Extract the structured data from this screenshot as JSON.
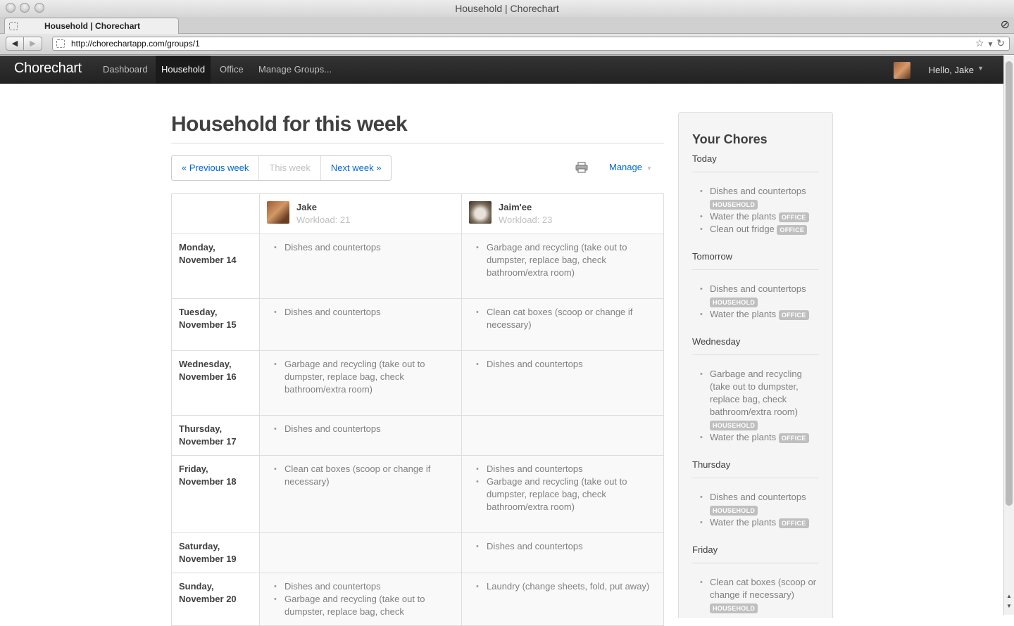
{
  "window": {
    "title": "Household | Chorechart",
    "tab_title": "Household | Chorechart",
    "url": "http://chorechartapp.com/groups/1"
  },
  "nav": {
    "brand": "Chorechart",
    "links": [
      "Dashboard",
      "Household",
      "Office",
      "Manage Groups..."
    ],
    "active": "Household",
    "user_greeting": "Hello, Jake"
  },
  "main": {
    "title": "Household for this week",
    "pager": {
      "prev": "« Previous week",
      "current": "This week",
      "next": "Next week »"
    },
    "manage_label": "Manage",
    "people": [
      {
        "name": "Jake",
        "workload": "Workload: 21"
      },
      {
        "name": "Jaim'ee",
        "workload": "Workload: 23"
      }
    ],
    "days": [
      {
        "label": "Monday,",
        "date": "November 14",
        "jake": [
          "Dishes and countertops"
        ],
        "jaimee": [
          "Garbage and recycling (take out to dumpster, replace bag, check bathroom/extra room)"
        ]
      },
      {
        "label": "Tuesday,",
        "date": "November 15",
        "jake": [
          "Dishes and countertops"
        ],
        "jaimee": [
          "Clean cat boxes (scoop or change if necessary)"
        ]
      },
      {
        "label": "Wednesday,",
        "date": "November 16",
        "jake": [
          "Garbage and recycling (take out to dumpster, replace bag, check bathroom/extra room)"
        ],
        "jaimee": [
          "Dishes and countertops"
        ]
      },
      {
        "label": "Thursday,",
        "date": "November 17",
        "jake": [
          "Dishes and countertops"
        ],
        "jaimee": []
      },
      {
        "label": "Friday,",
        "date": "November 18",
        "jake": [
          "Clean cat boxes (scoop or change if necessary)"
        ],
        "jaimee": [
          "Dishes and countertops",
          "Garbage and recycling (take out to dumpster, replace bag, check bathroom/extra room)"
        ]
      },
      {
        "label": "Saturday,",
        "date": "November 19",
        "jake": [],
        "jaimee": [
          "Dishes and countertops"
        ]
      },
      {
        "label": "Sunday,",
        "date": "November 20",
        "jake": [
          "Dishes and countertops",
          "Garbage and recycling (take out to dumpster, replace bag, check"
        ],
        "jaimee": [
          "Laundry (change sheets, fold, put away)"
        ]
      }
    ]
  },
  "sidebar": {
    "title": "Your Chores",
    "days": [
      {
        "label": "Today",
        "chores": [
          {
            "text": "Dishes and countertops",
            "badge": "HOUSEHOLD"
          },
          {
            "text": "Water the plants",
            "badge": "OFFICE"
          },
          {
            "text": "Clean out fridge",
            "badge": "OFFICE"
          }
        ]
      },
      {
        "label": "Tomorrow",
        "chores": [
          {
            "text": "Dishes and countertops",
            "badge": "HOUSEHOLD"
          },
          {
            "text": "Water the plants",
            "badge": "OFFICE"
          }
        ]
      },
      {
        "label": "Wednesday",
        "chores": [
          {
            "text": "Garbage and recycling (take out to dumpster, replace bag, check bathroom/extra room)",
            "badge": "HOUSEHOLD"
          },
          {
            "text": "Water the plants",
            "badge": "OFFICE"
          }
        ]
      },
      {
        "label": "Thursday",
        "chores": [
          {
            "text": "Dishes and countertops",
            "badge": "HOUSEHOLD"
          },
          {
            "text": "Water the plants",
            "badge": "OFFICE"
          }
        ]
      },
      {
        "label": "Friday",
        "chores": [
          {
            "text": "Clean cat boxes (scoop or change if necessary)",
            "badge": "HOUSEHOLD"
          }
        ]
      }
    ]
  },
  "colors": {
    "navbar": "#222222",
    "link": "#0069d6",
    "badge": "#bfbfbf"
  }
}
